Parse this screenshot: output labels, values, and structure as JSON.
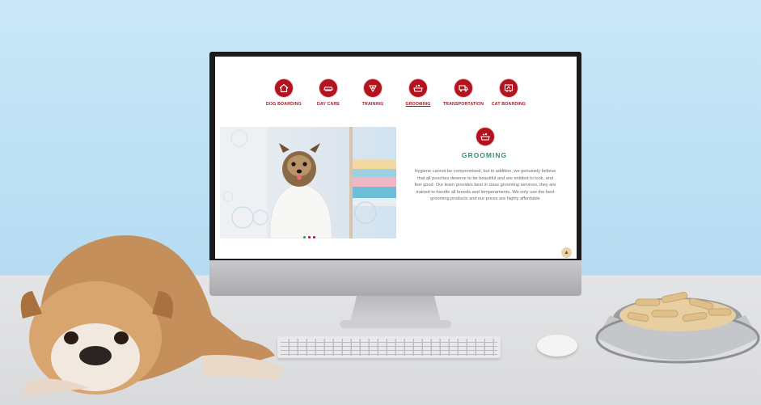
{
  "services": [
    {
      "label": "DOG BOARDING",
      "icon": "house-icon"
    },
    {
      "label": "DAY CARE",
      "icon": "sofa-icon"
    },
    {
      "label": "TRAINING",
      "icon": "bone-icon"
    },
    {
      "label": "GROOMING",
      "icon": "bathtub-icon"
    },
    {
      "label": "TRANSPORTATION",
      "icon": "truck-icon"
    },
    {
      "label": "CAT BOARDING",
      "icon": "cat-house-icon"
    }
  ],
  "active_service": "GROOMING",
  "detail": {
    "title": "GROOMING",
    "text": "Hygiene cannot be compromised, but in addition, we genuinely believe that all pooches deserve to be beautiful and are entitled to look, and feel good. Our team provides best in class grooming services, they are trained to handle all breeds and temperaments. We only use the best grooming products and our prices are highly affordable"
  },
  "colors": {
    "accent": "#b3121f",
    "title": "#3a8f6b",
    "sky": "#c9e7f8"
  }
}
